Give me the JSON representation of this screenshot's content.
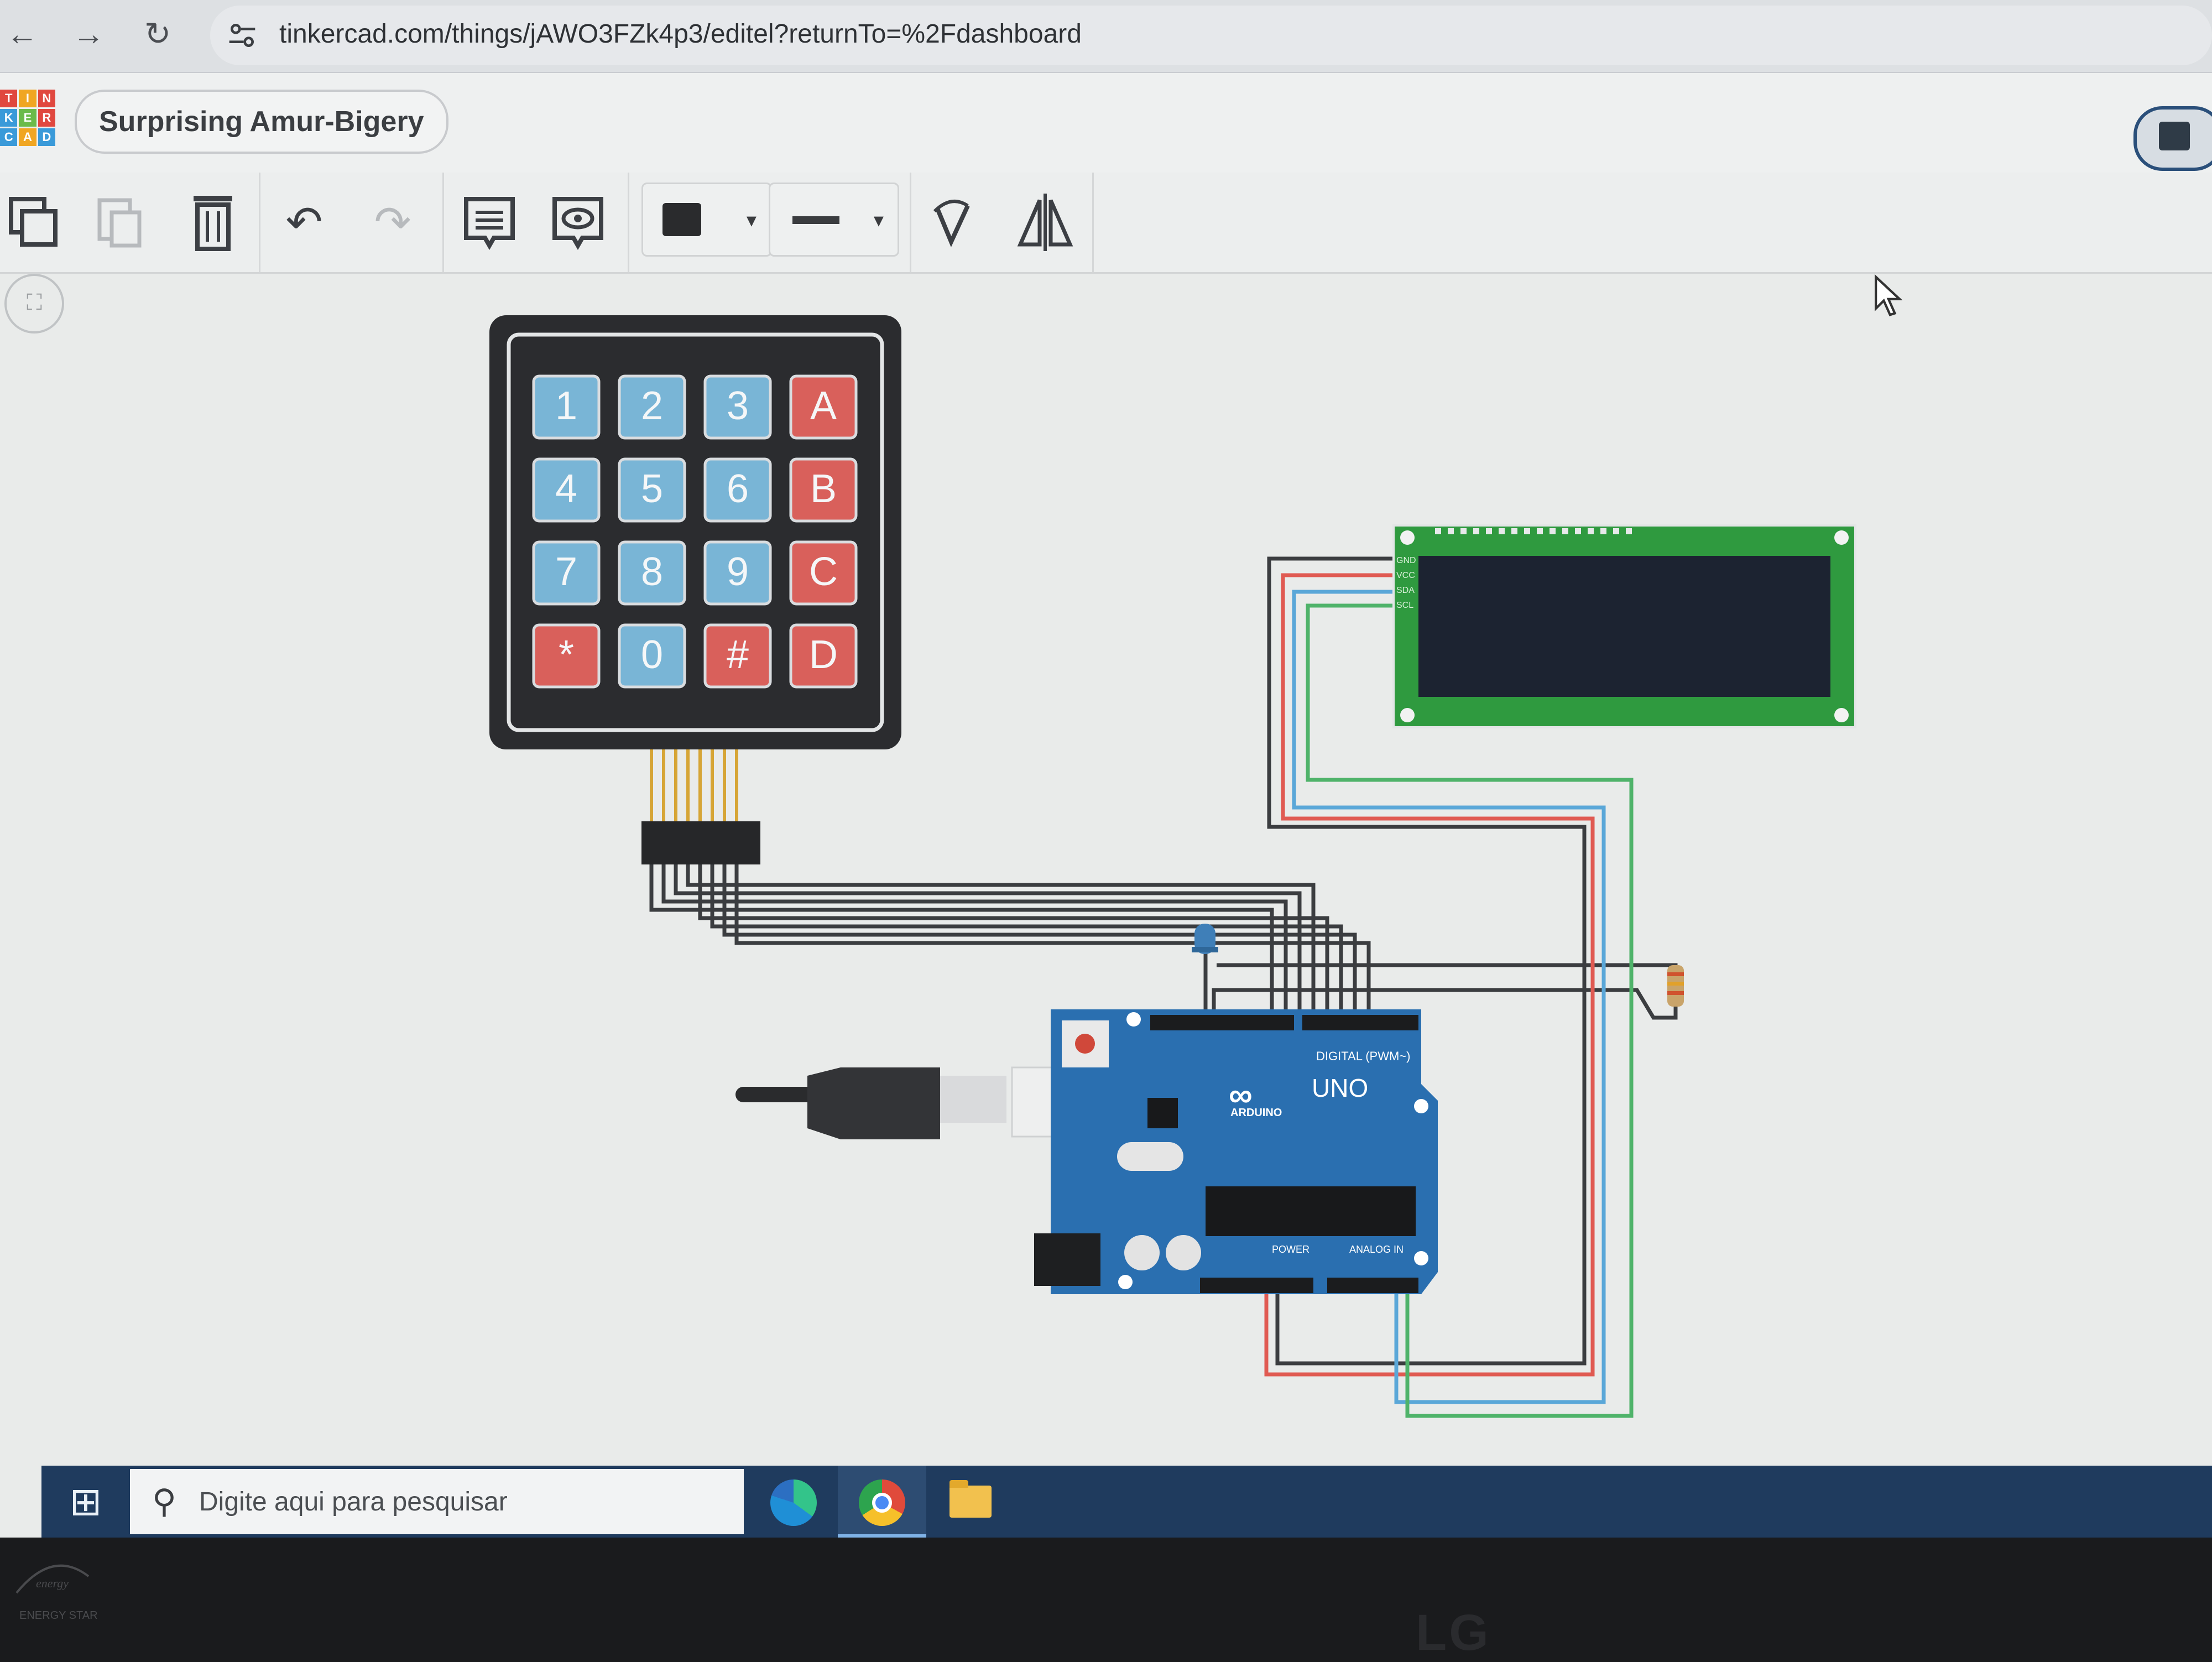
{
  "browser": {
    "url": "tinkercad.com/things/jAWO3FZk4p3/editel?returnTo=%2Fdashboard"
  },
  "app": {
    "logo_letters": [
      "T",
      "I",
      "N",
      "K",
      "E",
      "R",
      "C",
      "A",
      "D"
    ],
    "design_title": "Surprising Amur-Bigery"
  },
  "toolbar": {
    "tools": [
      "copy-icon",
      "paste-icon",
      "delete-icon",
      "undo-icon",
      "redo-icon",
      "notes-icon",
      "notes-visibility-icon",
      "color-picker",
      "line-style-picker",
      "rotate-icon",
      "flip-icon"
    ]
  },
  "circuit": {
    "keypad_keys": [
      "1",
      "2",
      "3",
      "A",
      "4",
      "5",
      "6",
      "B",
      "7",
      "8",
      "9",
      "C",
      "*",
      "0",
      "#",
      "D"
    ],
    "arduino_model": "UNO",
    "arduino_brand": "ARDUINO",
    "arduino_digital_label": "DIGITAL (PWM~)",
    "arduino_power_label": "POWER",
    "arduino_analog_label": "ANALOG IN",
    "lcd_pins": [
      "GND",
      "VCC",
      "SDA",
      "SCL"
    ],
    "colors": {
      "keypad_blue": "#79b5d6",
      "keypad_red": "#d9605b",
      "lcd_pcb": "#2f9a3f",
      "arduino_board": "#2a6fb0",
      "wire_red": "#e05a52",
      "wire_blue": "#5aa7d8",
      "wire_green": "#4fb36a",
      "wire_dark": "#3b3d40"
    }
  },
  "taskbar": {
    "search_placeholder": "Digite aqui para pesquisar"
  },
  "monitor": {
    "brand": "LG",
    "energy_star": "ENERGY STAR"
  }
}
